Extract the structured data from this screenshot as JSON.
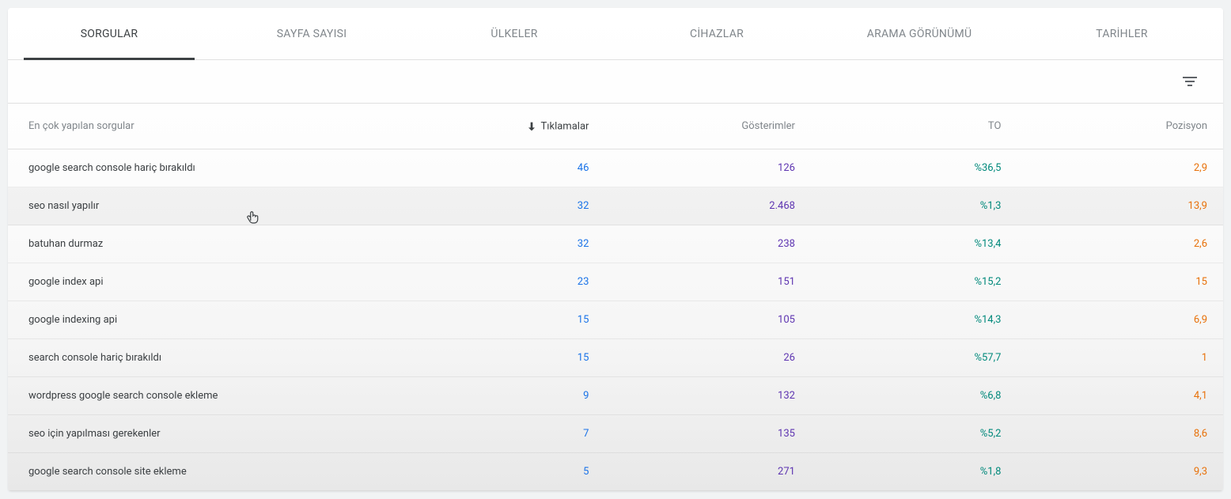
{
  "tabs": [
    {
      "label": "SORGULAR",
      "active": true
    },
    {
      "label": "SAYFA SAYISI",
      "active": false
    },
    {
      "label": "ÜLKELER",
      "active": false
    },
    {
      "label": "CİHAZLAR",
      "active": false
    },
    {
      "label": "ARAMA GÖRÜNÜMÜ",
      "active": false
    },
    {
      "label": "TARİHLER",
      "active": false
    }
  ],
  "columns": {
    "query": "En çok yapılan sorgular",
    "clicks": "Tıklamalar",
    "impressions": "Gösterimler",
    "ctr": "TO",
    "position": "Pozisyon"
  },
  "rows": [
    {
      "query": "google search console hariç bırakıldı",
      "clicks": "46",
      "impressions": "126",
      "ctr": "%36,5",
      "position": "2,9",
      "hover": false
    },
    {
      "query": "seo nasıl yapılır",
      "clicks": "32",
      "impressions": "2.468",
      "ctr": "%1,3",
      "position": "13,9",
      "hover": true
    },
    {
      "query": "batuhan durmaz",
      "clicks": "32",
      "impressions": "238",
      "ctr": "%13,4",
      "position": "2,6",
      "hover": false
    },
    {
      "query": "google index api",
      "clicks": "23",
      "impressions": "151",
      "ctr": "%15,2",
      "position": "15",
      "hover": false
    },
    {
      "query": "google indexing api",
      "clicks": "15",
      "impressions": "105",
      "ctr": "%14,3",
      "position": "6,9",
      "hover": false
    },
    {
      "query": "search console hariç bırakıldı",
      "clicks": "15",
      "impressions": "26",
      "ctr": "%57,7",
      "position": "1",
      "hover": false
    },
    {
      "query": "wordpress google search console ekleme",
      "clicks": "9",
      "impressions": "132",
      "ctr": "%6,8",
      "position": "4,1",
      "hover": false
    },
    {
      "query": "seo için yapılması gerekenler",
      "clicks": "7",
      "impressions": "135",
      "ctr": "%5,2",
      "position": "8,6",
      "hover": false
    },
    {
      "query": "google search console site ekleme",
      "clicks": "5",
      "impressions": "271",
      "ctr": "%1,8",
      "position": "9,3",
      "hover": false
    }
  ]
}
